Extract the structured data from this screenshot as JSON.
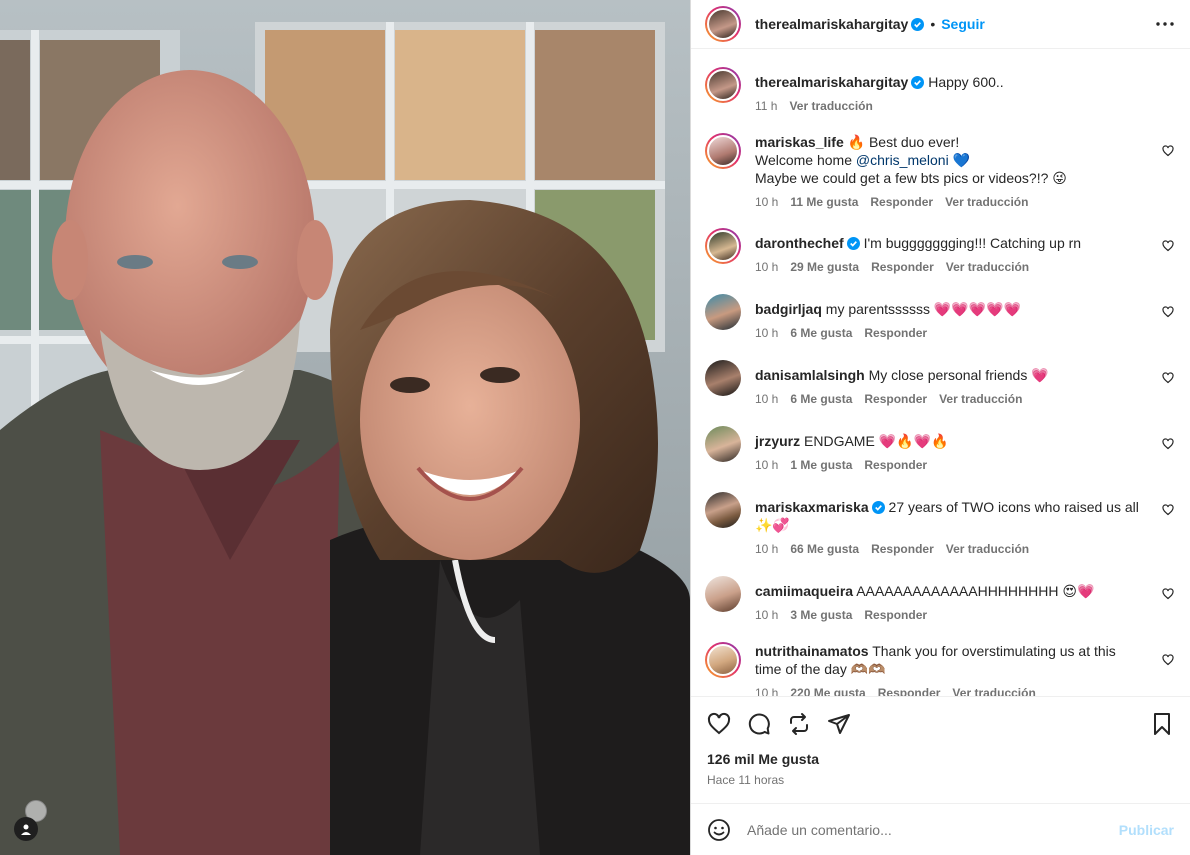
{
  "post": {
    "username": "therealmariskahargitay",
    "follow_label": "Seguir",
    "dot": "•"
  },
  "colors": {
    "accent": "#0095f6",
    "muted": "#737373",
    "heart": "#e8305c"
  },
  "caption": {
    "username": "therealmariskahargitay",
    "text": "Happy 600..",
    "time": "11 h",
    "translate": "Ver traducción"
  },
  "comments": [
    {
      "username": "mariskas_life",
      "lines": [
        "🔥 Best duo ever!",
        "Welcome home ",
        "Maybe we could get a few bts pics or videos?!? 😜"
      ],
      "mention": "@chris_meloni",
      "mention_after": " 💙",
      "time": "10 h",
      "likes": "11 Me gusta",
      "reply": "Responder",
      "translate": "Ver traducción"
    },
    {
      "username": "daronthechef",
      "verified": true,
      "text": "I'm buggggggging!!! Catching up rn",
      "time": "10 h",
      "likes": "29 Me gusta",
      "reply": "Responder",
      "translate": "Ver traducción"
    },
    {
      "username": "badgirljaq",
      "text": "my parentssssss 💗💗💗💗💗",
      "time": "10 h",
      "likes": "6 Me gusta",
      "reply": "Responder"
    },
    {
      "username": "danisamlalsingh",
      "text": "My close personal friends 💗",
      "time": "10 h",
      "likes": "6 Me gusta",
      "reply": "Responder",
      "translate": "Ver traducción"
    },
    {
      "username": "jrzyurz",
      "text": "ENDGAME 💗🔥💗🔥",
      "time": "10 h",
      "likes": "1 Me gusta",
      "reply": "Responder"
    },
    {
      "username": "mariskaxmariska",
      "verified": true,
      "text": "27 years of TWO icons who raised us all",
      "text2": "✨💞",
      "time": "10 h",
      "likes": "66 Me gusta",
      "reply": "Responder",
      "translate": "Ver traducción"
    },
    {
      "username": "camiimaqueira",
      "text": "AAAAAAAAAAAAAHHHHHHHH 😍💗",
      "time": "10 h",
      "likes": "3 Me gusta",
      "reply": "Responder"
    },
    {
      "username": "nutrithainamatos",
      "text": "Thank you for overstimulating us at this time of the day 🫶🏽🫶🏽",
      "time": "10 h",
      "likes": "220 Me gusta",
      "reply": "Responder",
      "translate": "Ver traducción"
    }
  ],
  "footer": {
    "likes": "126 mil Me gusta",
    "time": "Hace 11 horas",
    "comment_placeholder": "Añade un comentario...",
    "publish": "Publicar"
  },
  "icons": [
    "more-icon",
    "heart-icon",
    "comment-icon",
    "repost-icon",
    "share-icon",
    "bookmark-icon",
    "emoji-icon",
    "verified-icon"
  ]
}
